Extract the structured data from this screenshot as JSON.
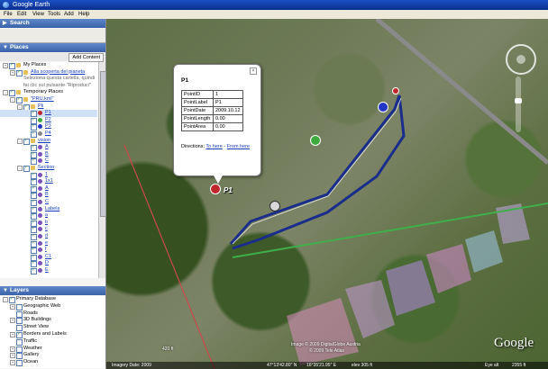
{
  "window": {
    "title": "Google Earth"
  },
  "menu": [
    "File",
    "Edit",
    "View",
    "Tools",
    "Add",
    "Help"
  ],
  "sidebar": {
    "search_header": "Search",
    "places_header": "Places",
    "add_content": "Add Content",
    "layers_header": "Layers",
    "places": [
      {
        "label": "My Places",
        "indent": 0,
        "check": true,
        "icon": "folder-icon",
        "exp": "+"
      },
      {
        "label": "Alla scoperta del pianeta",
        "indent": 1,
        "check": true,
        "icon": "folder-icon",
        "link": true,
        "exp": "+"
      },
      {
        "label": "Seleziona questa cartella, quindi",
        "indent": 2,
        "muted": true
      },
      {
        "label": "fai clic sul pulsante \"Riproduci\"",
        "indent": 2,
        "muted": true
      },
      {
        "label": "Temporary Places",
        "indent": 0,
        "check": true,
        "icon": "folder-icon",
        "exp": "-"
      },
      {
        "label": "\"PRU.kml\"",
        "indent": 1,
        "check": true,
        "icon": "folder-icon",
        "link": true,
        "exp": "-"
      },
      {
        "label": "Pk",
        "indent": 2,
        "check": true,
        "icon": "folder-icon",
        "link": true,
        "exp": "-"
      },
      {
        "label": "P1",
        "indent": 3,
        "check": true,
        "icon": "red-dot-icon",
        "link": true,
        "selected": true
      },
      {
        "label": "P2",
        "indent": 3,
        "check": true,
        "icon": "green-dot-icon",
        "link": true
      },
      {
        "label": "P3",
        "indent": 3,
        "check": true,
        "icon": "blue-dot-icon",
        "link": true
      },
      {
        "label": "P4",
        "indent": 3,
        "check": true,
        "icon": "gray-dot-icon",
        "link": true
      },
      {
        "label": "vision",
        "indent": 2,
        "check": true,
        "icon": "folder-icon",
        "link": true,
        "exp": "-"
      },
      {
        "label": "A",
        "indent": 3,
        "check": true,
        "icon": "purple-dot-icon",
        "link": true
      },
      {
        "label": "B",
        "indent": 3,
        "check": true,
        "icon": "purple-dot-icon",
        "link": true
      },
      {
        "label": "C",
        "indent": 3,
        "check": true,
        "icon": "purple-dot-icon",
        "link": true
      },
      {
        "label": "Section",
        "indent": 2,
        "check": true,
        "icon": "folder-icon",
        "link": true,
        "exp": "-"
      },
      {
        "label": "1",
        "indent": 3,
        "check": true,
        "icon": "purple-dot-icon",
        "link": true
      },
      {
        "label": "1x1",
        "indent": 3,
        "check": true,
        "icon": "purple-dot-icon",
        "link": true
      },
      {
        "label": "A",
        "indent": 3,
        "check": true,
        "icon": "purple-dot-icon",
        "link": true
      },
      {
        "label": "B",
        "indent": 3,
        "check": true,
        "icon": "purple-dot-icon",
        "link": true
      },
      {
        "label": "C",
        "indent": 3,
        "check": true,
        "icon": "purple-dot-icon",
        "link": true
      },
      {
        "label": "Labels",
        "indent": 3,
        "check": true,
        "icon": "purple-dot-icon",
        "link": true
      },
      {
        "label": "a",
        "indent": 3,
        "check": true,
        "icon": "purple-dot-icon",
        "link": true
      },
      {
        "label": "b",
        "indent": 3,
        "check": true,
        "icon": "purple-dot-icon",
        "link": true
      },
      {
        "label": "c",
        "indent": 3,
        "check": true,
        "icon": "purple-dot-icon",
        "link": true
      },
      {
        "label": "d",
        "indent": 3,
        "check": true,
        "icon": "purple-dot-icon",
        "link": true
      },
      {
        "label": "e",
        "indent": 3,
        "check": true,
        "icon": "purple-dot-icon",
        "link": true
      },
      {
        "label": "f",
        "indent": 3,
        "check": true,
        "icon": "purple-dot-icon",
        "link": true
      },
      {
        "label": "C1",
        "indent": 3,
        "check": true,
        "icon": "purple-dot-icon",
        "link": true
      },
      {
        "label": "D",
        "indent": 3,
        "check": true,
        "icon": "purple-dot-icon",
        "link": true
      },
      {
        "label": "E",
        "indent": 3,
        "check": true,
        "icon": "purple-dot-icon",
        "link": true
      }
    ],
    "layers": [
      {
        "label": "Primary Database",
        "indent": 0,
        "check": true,
        "exp": "-"
      },
      {
        "label": "Geographic Web",
        "indent": 1,
        "check": false,
        "exp": "+"
      },
      {
        "label": "Roads",
        "indent": 1,
        "check": false
      },
      {
        "label": "3D Buildings",
        "indent": 1,
        "check": false,
        "exp": "+"
      },
      {
        "label": "Street View",
        "indent": 1,
        "check": false
      },
      {
        "label": "Borders and Labels",
        "indent": 1,
        "check": true,
        "exp": "+"
      },
      {
        "label": "Traffic",
        "indent": 1,
        "check": false
      },
      {
        "label": "Weather",
        "indent": 1,
        "check": false,
        "exp": "+"
      },
      {
        "label": "Gallery",
        "indent": 1,
        "check": false,
        "exp": "+"
      },
      {
        "label": "Ocean",
        "indent": 1,
        "check": false,
        "exp": "+"
      }
    ]
  },
  "popup": {
    "title": "P1",
    "rows": [
      {
        "key": "PointID",
        "value": "1"
      },
      {
        "key": "PointLabel",
        "value": "P1"
      },
      {
        "key": "PointDate",
        "value": "2009.10.12"
      },
      {
        "key": "PointLength",
        "value": "0.00"
      },
      {
        "key": "PointArea",
        "value": "0.00"
      }
    ],
    "directions_label": "Directions:",
    "to_here": "To here",
    "sep": "-",
    "from_here": "From here"
  },
  "map": {
    "marker_label": "P1",
    "scale": "420 ft",
    "attribution_1": "Image © 2009 DigitalGlobe Austria",
    "attribution_2": "© 2009 Tele Atlas",
    "brand": "Google",
    "status": {
      "loading": "Imagery Date: 2009",
      "coords": "47°13'42.80\" N",
      "lon": "16°35'21.95\" E",
      "elev": "elev 305 ft",
      "eye": "Eye alt",
      "eye_val": "2355 ft"
    }
  }
}
